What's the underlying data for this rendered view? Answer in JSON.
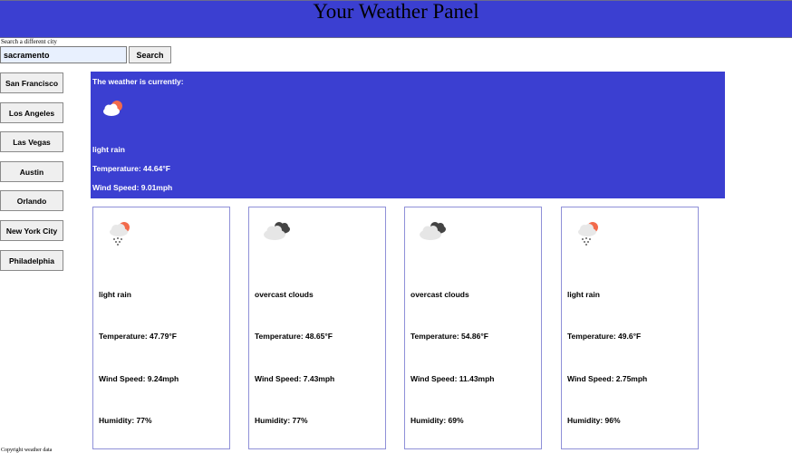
{
  "header": {
    "title": "Your Weather Panel"
  },
  "search": {
    "label": "Search a different city",
    "value": "sacramento",
    "button_label": "Search"
  },
  "cities": [
    "San Francisco",
    "Los Angeles",
    "Las Vegas",
    "Austin",
    "Orlando",
    "New York City",
    "Philadelphia"
  ],
  "current": {
    "heading": "The weather is currently:",
    "icon": "sun-behind-cloud-icon",
    "description": "light rain",
    "temperature": "Temperature: 44.64°F",
    "wind": "Wind Speed: 9.01mph"
  },
  "forecast": [
    {
      "icon": "rain-cloud-sun-icon",
      "description": "light rain",
      "temperature": "Temperature: 47.79°F",
      "wind": "Wind Speed: 9.24mph",
      "humidity": "Humidity: 77%"
    },
    {
      "icon": "overcast-clouds-icon",
      "description": "overcast clouds",
      "temperature": "Temperature: 48.65°F",
      "wind": "Wind Speed: 7.43mph",
      "humidity": "Humidity: 77%"
    },
    {
      "icon": "overcast-clouds-icon",
      "description": "overcast clouds",
      "temperature": "Temperature: 54.86°F",
      "wind": "Wind Speed: 11.43mph",
      "humidity": "Humidity: 69%"
    },
    {
      "icon": "rain-cloud-sun-icon",
      "description": "light rain",
      "temperature": "Temperature: 49.6°F",
      "wind": "Wind Speed: 2.75mph",
      "humidity": "Humidity: 96%"
    }
  ],
  "footer": {
    "text": "Copyright weather data"
  },
  "colors": {
    "header_bg": "#3b3fd1",
    "current_bg": "#3b3fd1",
    "card_border": "#8f90d8",
    "sun": "#f26a4b"
  }
}
